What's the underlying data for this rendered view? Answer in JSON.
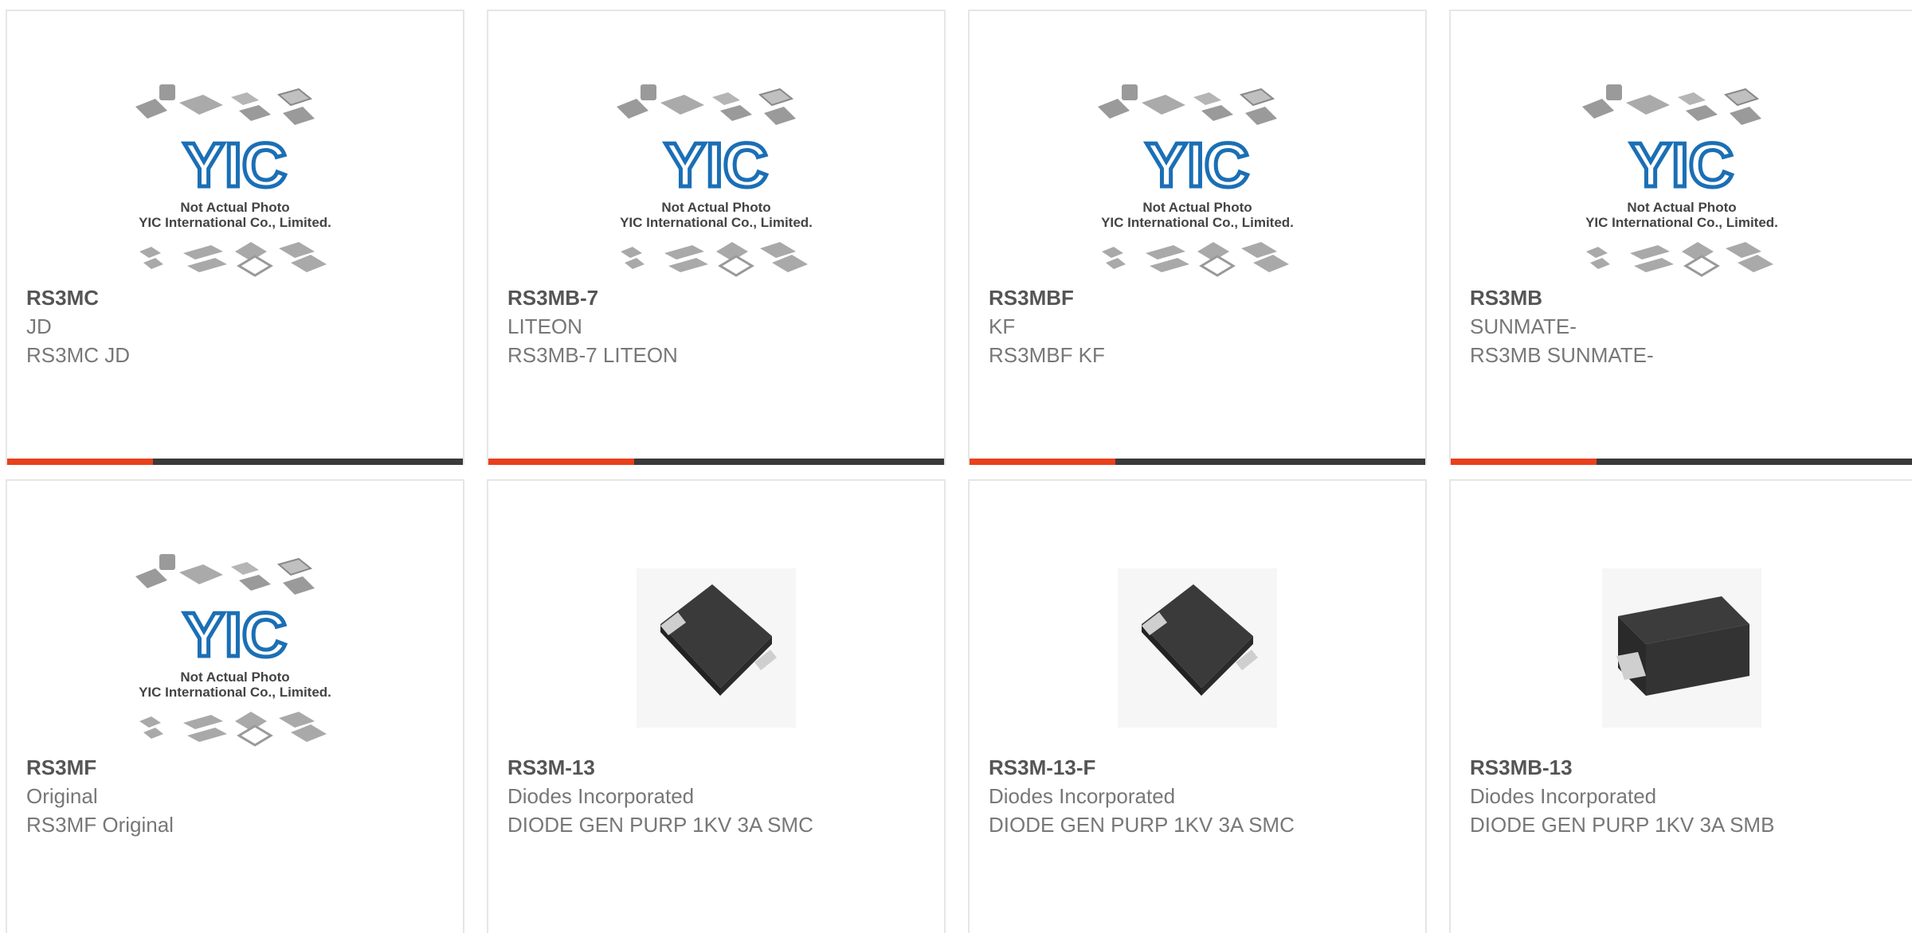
{
  "colors": {
    "accent": "#e8401c",
    "bar": "#3a3a3a",
    "logo_blue": "#1b6fb5",
    "border": "#e6e6e6"
  },
  "placeholder": {
    "line1": "Not Actual Photo",
    "line2": "YIC International Co., Limited.",
    "logo_text": "YIC"
  },
  "products": [
    {
      "part": "RS3MC",
      "maker": "JD",
      "desc": "RS3MC JD",
      "image": "yic-placeholder"
    },
    {
      "part": "RS3MB-7",
      "maker": "LITEON",
      "desc": "RS3MB-7 LITEON",
      "image": "yic-placeholder"
    },
    {
      "part": "RS3MBF",
      "maker": "KF",
      "desc": "RS3MBF KF",
      "image": "yic-placeholder"
    },
    {
      "part": "RS3MB",
      "maker": "SUNMATE-",
      "desc": "RS3MB SUNMATE-",
      "image": "yic-placeholder"
    },
    {
      "part": "RS3MF",
      "maker": "Original",
      "desc": "RS3MF Original",
      "image": "yic-placeholder"
    },
    {
      "part": "RS3M-13",
      "maker": "Diodes Incorporated",
      "desc": "DIODE GEN PURP 1KV 3A SMC",
      "image": "smc-diode-package"
    },
    {
      "part": "RS3M-13-F",
      "maker": "Diodes Incorporated",
      "desc": "DIODE GEN PURP 1KV 3A SMC",
      "image": "smc-diode-package"
    },
    {
      "part": "RS3MB-13",
      "maker": "Diodes Incorporated",
      "desc": "DIODE GEN PURP 1KV 3A SMB",
      "image": "smb-diode-package"
    }
  ]
}
